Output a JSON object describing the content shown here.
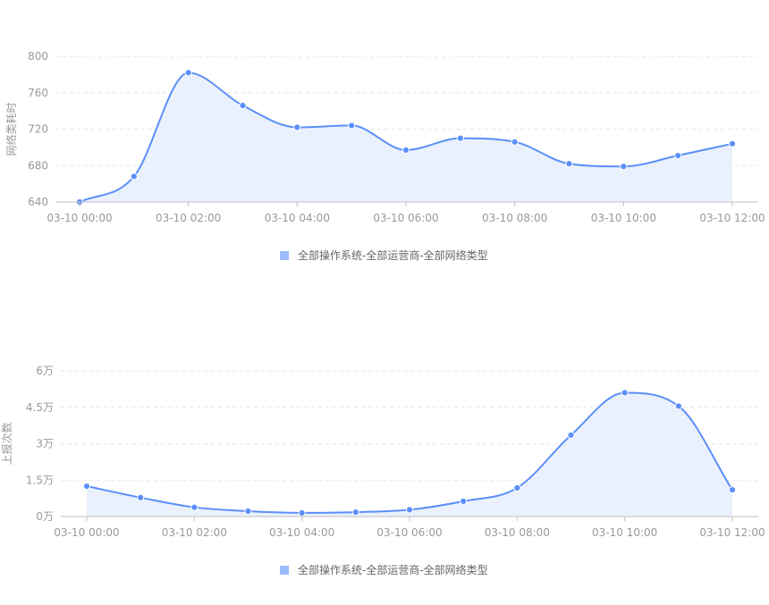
{
  "colors": {
    "series": "#5b8ff9",
    "area": "#eaf1fd",
    "legend_swatch": "#9bbcf9",
    "grid": "#e6e6e6",
    "axis": "#bfbfbf",
    "tick_text": "#999999"
  },
  "chart_data": [
    {
      "type": "area",
      "ylabel": "网络类耗时",
      "xlabel": "",
      "title": "",
      "x": [
        "03-10 00:00",
        "03-10 01:00",
        "03-10 02:00",
        "03-10 03:00",
        "03-10 04:00",
        "03-10 05:00",
        "03-10 06:00",
        "03-10 07:00",
        "03-10 08:00",
        "03-10 09:00",
        "03-10 10:00",
        "03-10 11:00",
        "03-10 12:00"
      ],
      "x_tick_labels": [
        "03-10 00:00",
        "03-10 02:00",
        "03-10 04:00",
        "03-10 06:00",
        "03-10 08:00",
        "03-10 10:00",
        "03-10 12:00"
      ],
      "ylim": [
        640,
        800
      ],
      "y_ticks": [
        640,
        680,
        720,
        760,
        800
      ],
      "y_tick_labels": [
        "640",
        "680",
        "720",
        "760",
        "800"
      ],
      "grid": true,
      "legend_position": "bottom-center",
      "series": [
        {
          "name": "全部操作系统-全部运营商-全部网络类型",
          "values": [
            640,
            668,
            782,
            746,
            722,
            724,
            697,
            710,
            706,
            682,
            679,
            691,
            704
          ]
        }
      ]
    },
    {
      "type": "area",
      "ylabel": "上报次数",
      "xlabel": "",
      "title": "",
      "x": [
        "03-10 00:00",
        "03-10 01:00",
        "03-10 02:00",
        "03-10 03:00",
        "03-10 04:00",
        "03-10 05:00",
        "03-10 06:00",
        "03-10 07:00",
        "03-10 08:00",
        "03-10 09:00",
        "03-10 10:00",
        "03-10 11:00",
        "03-10 12:00"
      ],
      "x_tick_labels": [
        "03-10 00:00",
        "03-10 02:00",
        "03-10 04:00",
        "03-10 06:00",
        "03-10 08:00",
        "03-10 10:00",
        "03-10 12:00"
      ],
      "ylim": [
        0,
        60000
      ],
      "y_ticks": [
        0,
        15000,
        30000,
        45000,
        60000
      ],
      "y_tick_labels": [
        "0万",
        "1.5万",
        "3万",
        "4.5万",
        "6万"
      ],
      "grid": true,
      "legend_position": "bottom-center",
      "series": [
        {
          "name": "全部操作系统-全部运营商-全部网络类型",
          "values": [
            12500,
            7800,
            3800,
            2200,
            1500,
            1800,
            2800,
            6300,
            11800,
            33500,
            51000,
            45500,
            11000
          ]
        }
      ]
    }
  ]
}
